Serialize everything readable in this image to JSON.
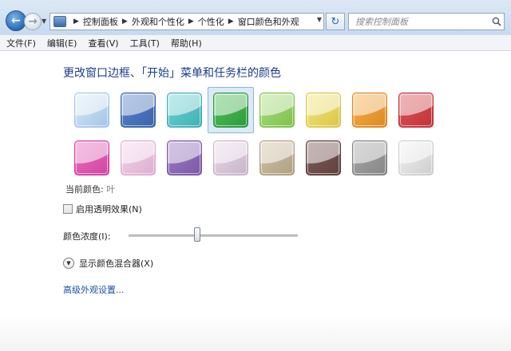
{
  "nav": {
    "back_icon": "back-arrow-icon",
    "forward_icon": "forward-arrow-icon"
  },
  "address": {
    "icon": "control-panel-icon",
    "crumbs": [
      "控制面板",
      "外观和个性化",
      "个性化",
      "窗口颜色和外观"
    ]
  },
  "search": {
    "placeholder": "搜索控制面板"
  },
  "menu": [
    "文件(F)",
    "编辑(E)",
    "查看(V)",
    "工具(T)",
    "帮助(H)"
  ],
  "main": {
    "heading": "更改窗口边框、「开始」菜单和任务栏的颜色",
    "current_color_label": "当前颜色:",
    "current_color_value": "叶",
    "transparency_label": "启用透明效果(N)",
    "transparency_checked": false,
    "intensity_label": "颜色浓度(I):",
    "intensity_level": 0.4,
    "mixer_label": "显示颜色混合器(X)",
    "advanced_link": "高级外观设置..."
  },
  "swatches": {
    "selected_index": 3,
    "row1": [
      {
        "color": "#dcecf8",
        "edge": "#9fc4e6"
      },
      {
        "color": "#5c86cc",
        "edge": "#3a63a8"
      },
      {
        "color": "#6fd4d6",
        "edge": "#3fb0b4"
      },
      {
        "color": "#4cc25a",
        "edge": "#2f9a3c"
      },
      {
        "color": "#a9e07a",
        "edge": "#7fc04e"
      },
      {
        "color": "#f5e77a",
        "edge": "#d9c548"
      },
      {
        "color": "#f6ae4a",
        "edge": "#dc8a20"
      },
      {
        "color": "#e0555a",
        "edge": "#bf3338"
      }
    ],
    "row2": [
      {
        "color": "#ec6ec0",
        "edge": "#cf45a0"
      },
      {
        "color": "#f6d2ec",
        "edge": "#dcaed0"
      },
      {
        "color": "#9e7cc4",
        "edge": "#7c58a6"
      },
      {
        "color": "#e8d8e8",
        "edge": "#c8b4c8"
      },
      {
        "color": "#d2c2a6",
        "edge": "#b0a082"
      },
      {
        "color": "#7e5e5a",
        "edge": "#5e403c"
      },
      {
        "color": "#a8a8a8",
        "edge": "#868686"
      },
      {
        "color": "#f2f2f2",
        "edge": "#cdcdcd"
      }
    ]
  }
}
